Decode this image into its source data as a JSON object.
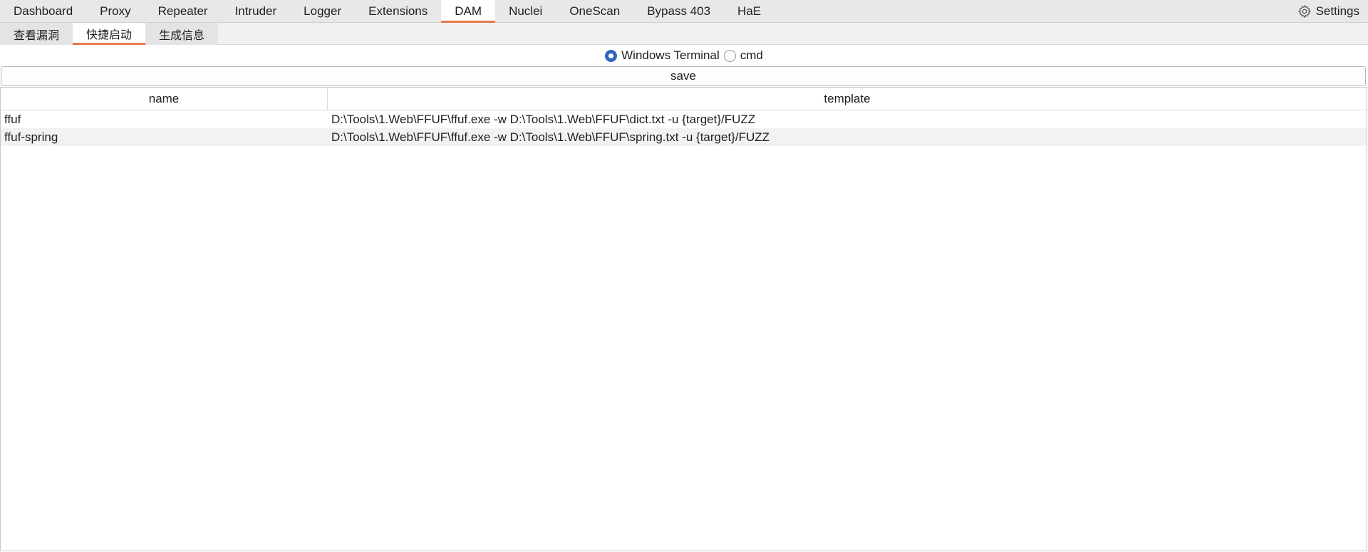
{
  "top_tabs": [
    {
      "label": "Dashboard"
    },
    {
      "label": "Proxy"
    },
    {
      "label": "Repeater"
    },
    {
      "label": "Intruder"
    },
    {
      "label": "Logger"
    },
    {
      "label": "Extensions"
    },
    {
      "label": "DAM"
    },
    {
      "label": "Nuclei"
    },
    {
      "label": "OneScan"
    },
    {
      "label": "Bypass 403"
    },
    {
      "label": "HaE"
    }
  ],
  "active_top_tab": "DAM",
  "settings": {
    "label": "Settings",
    "icon": "gear-icon"
  },
  "sub_tabs": [
    {
      "label": "查看漏洞"
    },
    {
      "label": "快捷启动"
    },
    {
      "label": "生成信息"
    }
  ],
  "active_sub_tab": "快捷启动",
  "terminal_options": [
    {
      "label": "Windows Terminal",
      "selected": true
    },
    {
      "label": "cmd",
      "selected": false
    }
  ],
  "save_button": {
    "label": "save"
  },
  "table": {
    "columns": [
      "name",
      "template"
    ],
    "rows": [
      {
        "name": "ffuf",
        "template": "D:\\Tools\\1.Web\\FFUF\\ffuf.exe -w D:\\Tools\\1.Web\\FFUF\\dict.txt -u {target}/FUZZ"
      },
      {
        "name": "ffuf-spring",
        "template": "D:\\Tools\\1.Web\\FFUF\\ffuf.exe -w D:\\Tools\\1.Web\\FFUF\\spring.txt -u {target}/FUZZ"
      }
    ]
  },
  "colors": {
    "accent": "#e8774a",
    "radio_selected": "#2f67c1"
  }
}
